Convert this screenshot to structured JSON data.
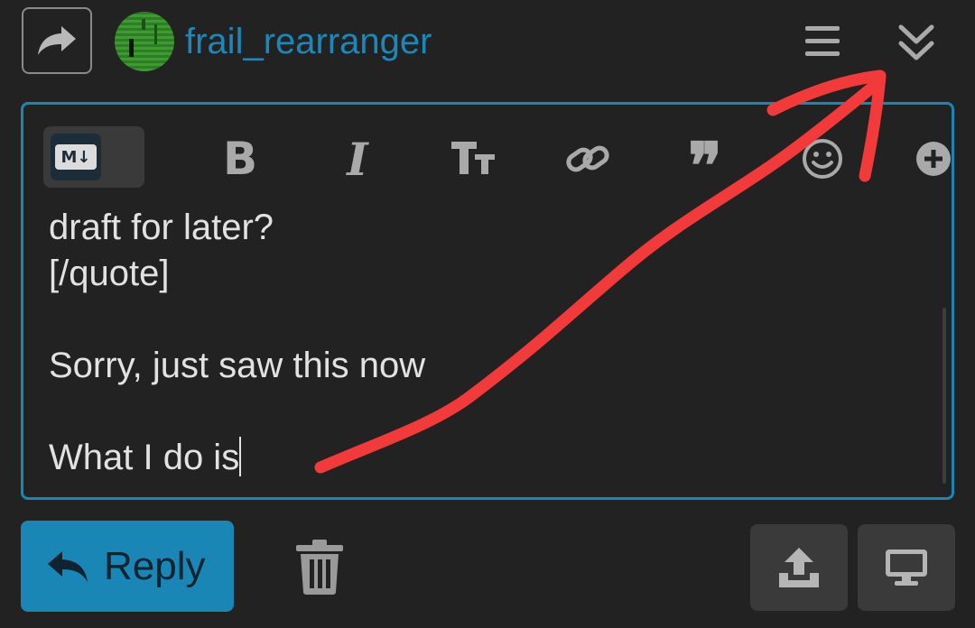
{
  "header": {
    "username": "frail_rearranger",
    "share_icon": "share-icon",
    "menu_icon": "hamburger-menu-icon",
    "collapse_icon": "double-chevron-down-icon"
  },
  "toolbar": {
    "markdown_label": "M↓",
    "bold": "B",
    "italic": "I",
    "quote": "❞"
  },
  "editor": {
    "lines": [
      "draft for later?",
      "[/quote]",
      "",
      "Sorry, just saw this now",
      "",
      "What I do is"
    ]
  },
  "footer": {
    "reply_label": "Reply",
    "icons": [
      "reply-arrow-icon",
      "trash-icon",
      "upload-icon",
      "desktop-preview-icon"
    ]
  },
  "colors": {
    "background": "#222222",
    "accent": "#1a86b5",
    "annotation": "#f23a3a"
  }
}
